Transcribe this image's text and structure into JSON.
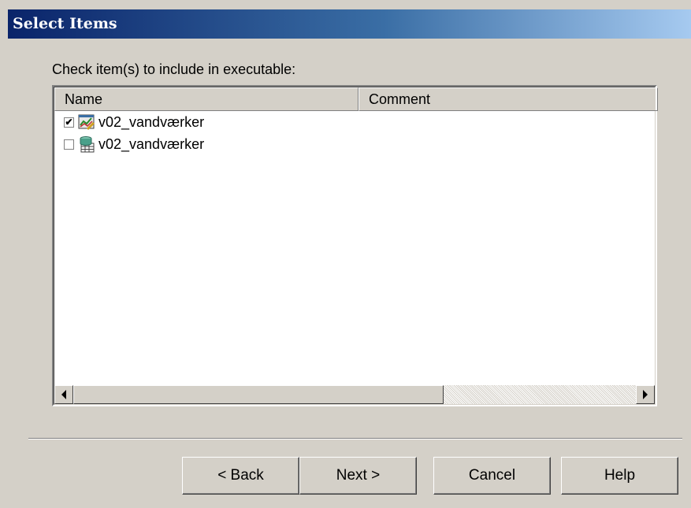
{
  "window": {
    "title": "Select Items"
  },
  "prompt": "Check item(s) to include in executable:",
  "list": {
    "columns": [
      "Name",
      "Comment"
    ],
    "items": [
      {
        "checked": true,
        "icon": "report-chart-icon",
        "name": "v02_vandværker",
        "comment": ""
      },
      {
        "checked": false,
        "icon": "database-table-icon",
        "name": "v02_vandværker",
        "comment": ""
      }
    ],
    "horizontal_scroll_fraction": 0.65
  },
  "buttons": {
    "back": "< Back",
    "next": "Next >",
    "cancel": "Cancel",
    "help": "Help"
  },
  "colors": {
    "dialog_face": "#d4d0c8",
    "title_gradient_start": "#0a246a",
    "title_gradient_end": "#a6caf0"
  }
}
